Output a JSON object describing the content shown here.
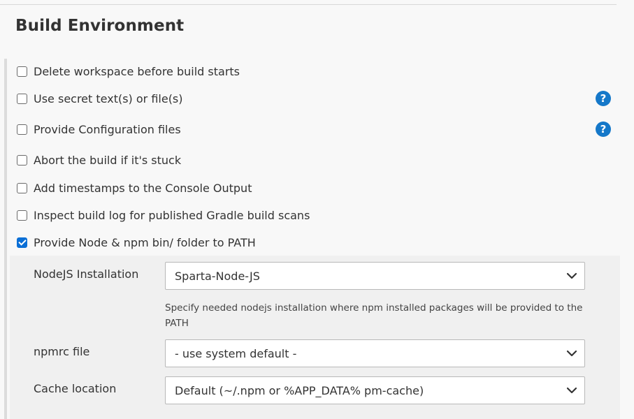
{
  "section": {
    "title": "Build Environment"
  },
  "options": [
    {
      "label": "Delete workspace before build starts",
      "checked": false
    },
    {
      "label": "Use secret text(s) or file(s)",
      "checked": false
    },
    {
      "label": "Provide Configuration files",
      "checked": false
    },
    {
      "label": "Abort the build if it's stuck",
      "checked": false
    },
    {
      "label": "Add timestamps to the Console Output",
      "checked": false
    },
    {
      "label": "Inspect build log for published Gradle build scans",
      "checked": false
    },
    {
      "label": "Provide Node & npm bin/ folder to PATH",
      "checked": true
    }
  ],
  "help": {
    "symbol": "?",
    "icon": "help-icon",
    "color": "#1578c9"
  },
  "node_config": {
    "nodejs_installation": {
      "label": "NodeJS Installation",
      "value": "Sparta-Node-JS",
      "help_text": "Specify needed nodejs installation where npm installed packages will be provided to the PATH"
    },
    "npmrc_file": {
      "label": "npmrc file",
      "value": "- use system default -"
    },
    "cache_location": {
      "label": "Cache location",
      "value": "Default (~/.npm or %APP_DATA% pm-cache)"
    }
  },
  "colors": {
    "accent": "#0b6fd6",
    "background": "#f8f8f8",
    "panel": "#f0f0f0"
  }
}
